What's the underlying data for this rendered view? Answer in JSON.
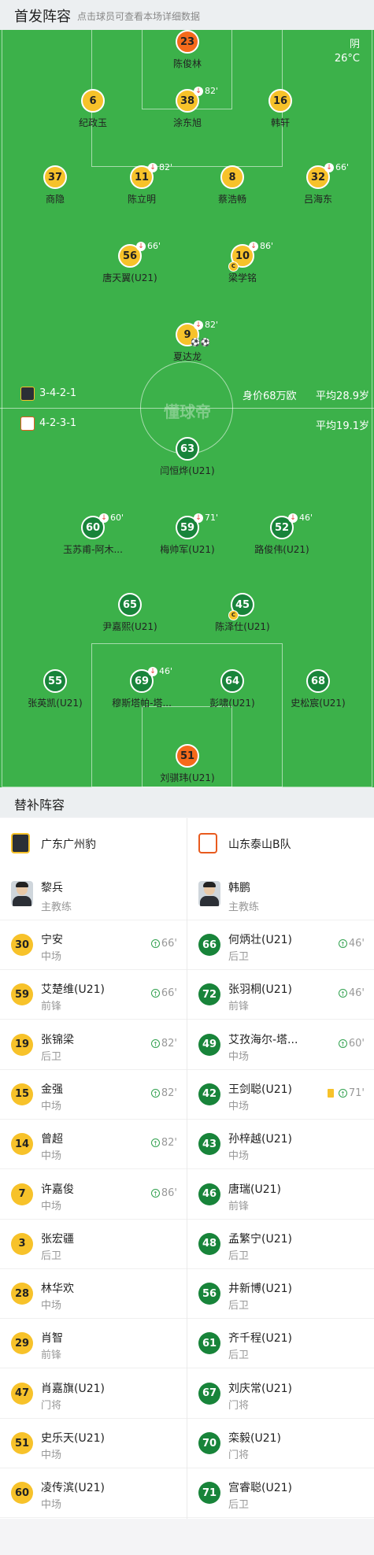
{
  "header": {
    "title": "首发阵容",
    "subtitle": "点击球员可查看本场详细数据"
  },
  "weather": {
    "condition": "阴",
    "temp": "26°C"
  },
  "watermark": "懂球帝",
  "home": {
    "formation": "3-4-2-1",
    "value": "身价68万欧",
    "avg_age": "平均28.9岁",
    "players": [
      {
        "num": "23",
        "name": "陈俊林",
        "color": "orange"
      },
      {
        "num": "6",
        "name": "纪政玉",
        "color": "yellow"
      },
      {
        "num": "38",
        "name": "涂东旭",
        "color": "yellow",
        "sub": "82'"
      },
      {
        "num": "16",
        "name": "韩轩",
        "color": "yellow"
      },
      {
        "num": "37",
        "name": "商隐",
        "color": "yellow"
      },
      {
        "num": "11",
        "name": "陈立明",
        "color": "yellow",
        "sub": "82'"
      },
      {
        "num": "8",
        "name": "蔡浩畅",
        "color": "yellow"
      },
      {
        "num": "32",
        "name": "吕海东",
        "color": "yellow",
        "sub": "66'"
      },
      {
        "num": "56",
        "name": "唐天翼(U21)",
        "color": "yellow",
        "sub": "66'"
      },
      {
        "num": "10",
        "name": "梁学铭",
        "color": "yellow",
        "sub": "86'",
        "captain": "C"
      },
      {
        "num": "9",
        "name": "夏达龙",
        "color": "yellow",
        "sub": "82'",
        "goals": "⚽⚽"
      }
    ]
  },
  "away": {
    "formation": "4-2-3-1",
    "avg_age": "平均19.1岁",
    "players": [
      {
        "num": "63",
        "name": "闫恒烨(U21)",
        "color": "green"
      },
      {
        "num": "60",
        "name": "玉苏甫-阿木...",
        "color": "green",
        "sub": "60'"
      },
      {
        "num": "59",
        "name": "梅帅军(U21)",
        "color": "green",
        "sub": "71'"
      },
      {
        "num": "52",
        "name": "路俊伟(U21)",
        "color": "green",
        "sub": "46'"
      },
      {
        "num": "65",
        "name": "尹嘉熙(U21)",
        "color": "green"
      },
      {
        "num": "45",
        "name": "陈泽仕(U21)",
        "color": "green",
        "captain": "C"
      },
      {
        "num": "55",
        "name": "张英凯(U21)",
        "color": "green"
      },
      {
        "num": "69",
        "name": "穆斯塔帕-塔...",
        "color": "green",
        "sub": "46'"
      },
      {
        "num": "64",
        "name": "彭啸(U21)",
        "color": "green"
      },
      {
        "num": "68",
        "name": "史松宸(U21)",
        "color": "green"
      },
      {
        "num": "51",
        "name": "刘骐玮(U21)",
        "color": "orange"
      }
    ]
  },
  "subs_header": "替补阵容",
  "left_team": {
    "name": "广东广州豹",
    "coach": "黎兵",
    "coach_role": "主教练",
    "subs": [
      {
        "num": "30",
        "name": "宁安",
        "pos": "中场",
        "time": "66'"
      },
      {
        "num": "59",
        "name": "艾楚维(U21)",
        "pos": "前锋",
        "time": "66'"
      },
      {
        "num": "19",
        "name": "张锦梁",
        "pos": "后卫",
        "time": "82'"
      },
      {
        "num": "15",
        "name": "金强",
        "pos": "中场",
        "time": "82'"
      },
      {
        "num": "14",
        "name": "曾超",
        "pos": "中场",
        "time": "82'"
      },
      {
        "num": "7",
        "name": "许嘉俊",
        "pos": "中场",
        "time": "86'"
      },
      {
        "num": "3",
        "name": "张宏疆",
        "pos": "后卫"
      },
      {
        "num": "28",
        "name": "林华欢",
        "pos": "中场"
      },
      {
        "num": "29",
        "name": "肖智",
        "pos": "前锋"
      },
      {
        "num": "47",
        "name": "肖嘉旗(U21)",
        "pos": "门将"
      },
      {
        "num": "51",
        "name": "史乐天(U21)",
        "pos": "中场"
      },
      {
        "num": "60",
        "name": "凌传滨(U21)",
        "pos": "中场"
      }
    ]
  },
  "right_team": {
    "name": "山东泰山B队",
    "coach": "韩鹏",
    "coach_role": "主教练",
    "subs": [
      {
        "num": "66",
        "name": "何炳壮(U21)",
        "pos": "后卫",
        "time": "46'"
      },
      {
        "num": "72",
        "name": "张羽桐(U21)",
        "pos": "前锋",
        "time": "46'"
      },
      {
        "num": "49",
        "name": "艾孜海尔-塔...",
        "pos": "中场",
        "time": "60'"
      },
      {
        "num": "42",
        "name": "王剑聪(U21)",
        "pos": "中场",
        "time": "71'",
        "card": "yellow"
      },
      {
        "num": "43",
        "name": "孙梓越(U21)",
        "pos": "中场"
      },
      {
        "num": "46",
        "name": "唐瑞(U21)",
        "pos": "前锋"
      },
      {
        "num": "48",
        "name": "孟繁宁(U21)",
        "pos": "后卫"
      },
      {
        "num": "56",
        "name": "井新博(U21)",
        "pos": "后卫"
      },
      {
        "num": "61",
        "name": "齐千程(U21)",
        "pos": "后卫"
      },
      {
        "num": "67",
        "name": "刘庆常(U21)",
        "pos": "门将"
      },
      {
        "num": "70",
        "name": "栾毅(U21)",
        "pos": "门将"
      },
      {
        "num": "71",
        "name": "宫睿聪(U21)",
        "pos": "后卫"
      }
    ]
  },
  "colors": {
    "pitch": "#3cb14a",
    "home": "#f7c22a",
    "away": "#18843a",
    "gk": "#f56a1b"
  }
}
